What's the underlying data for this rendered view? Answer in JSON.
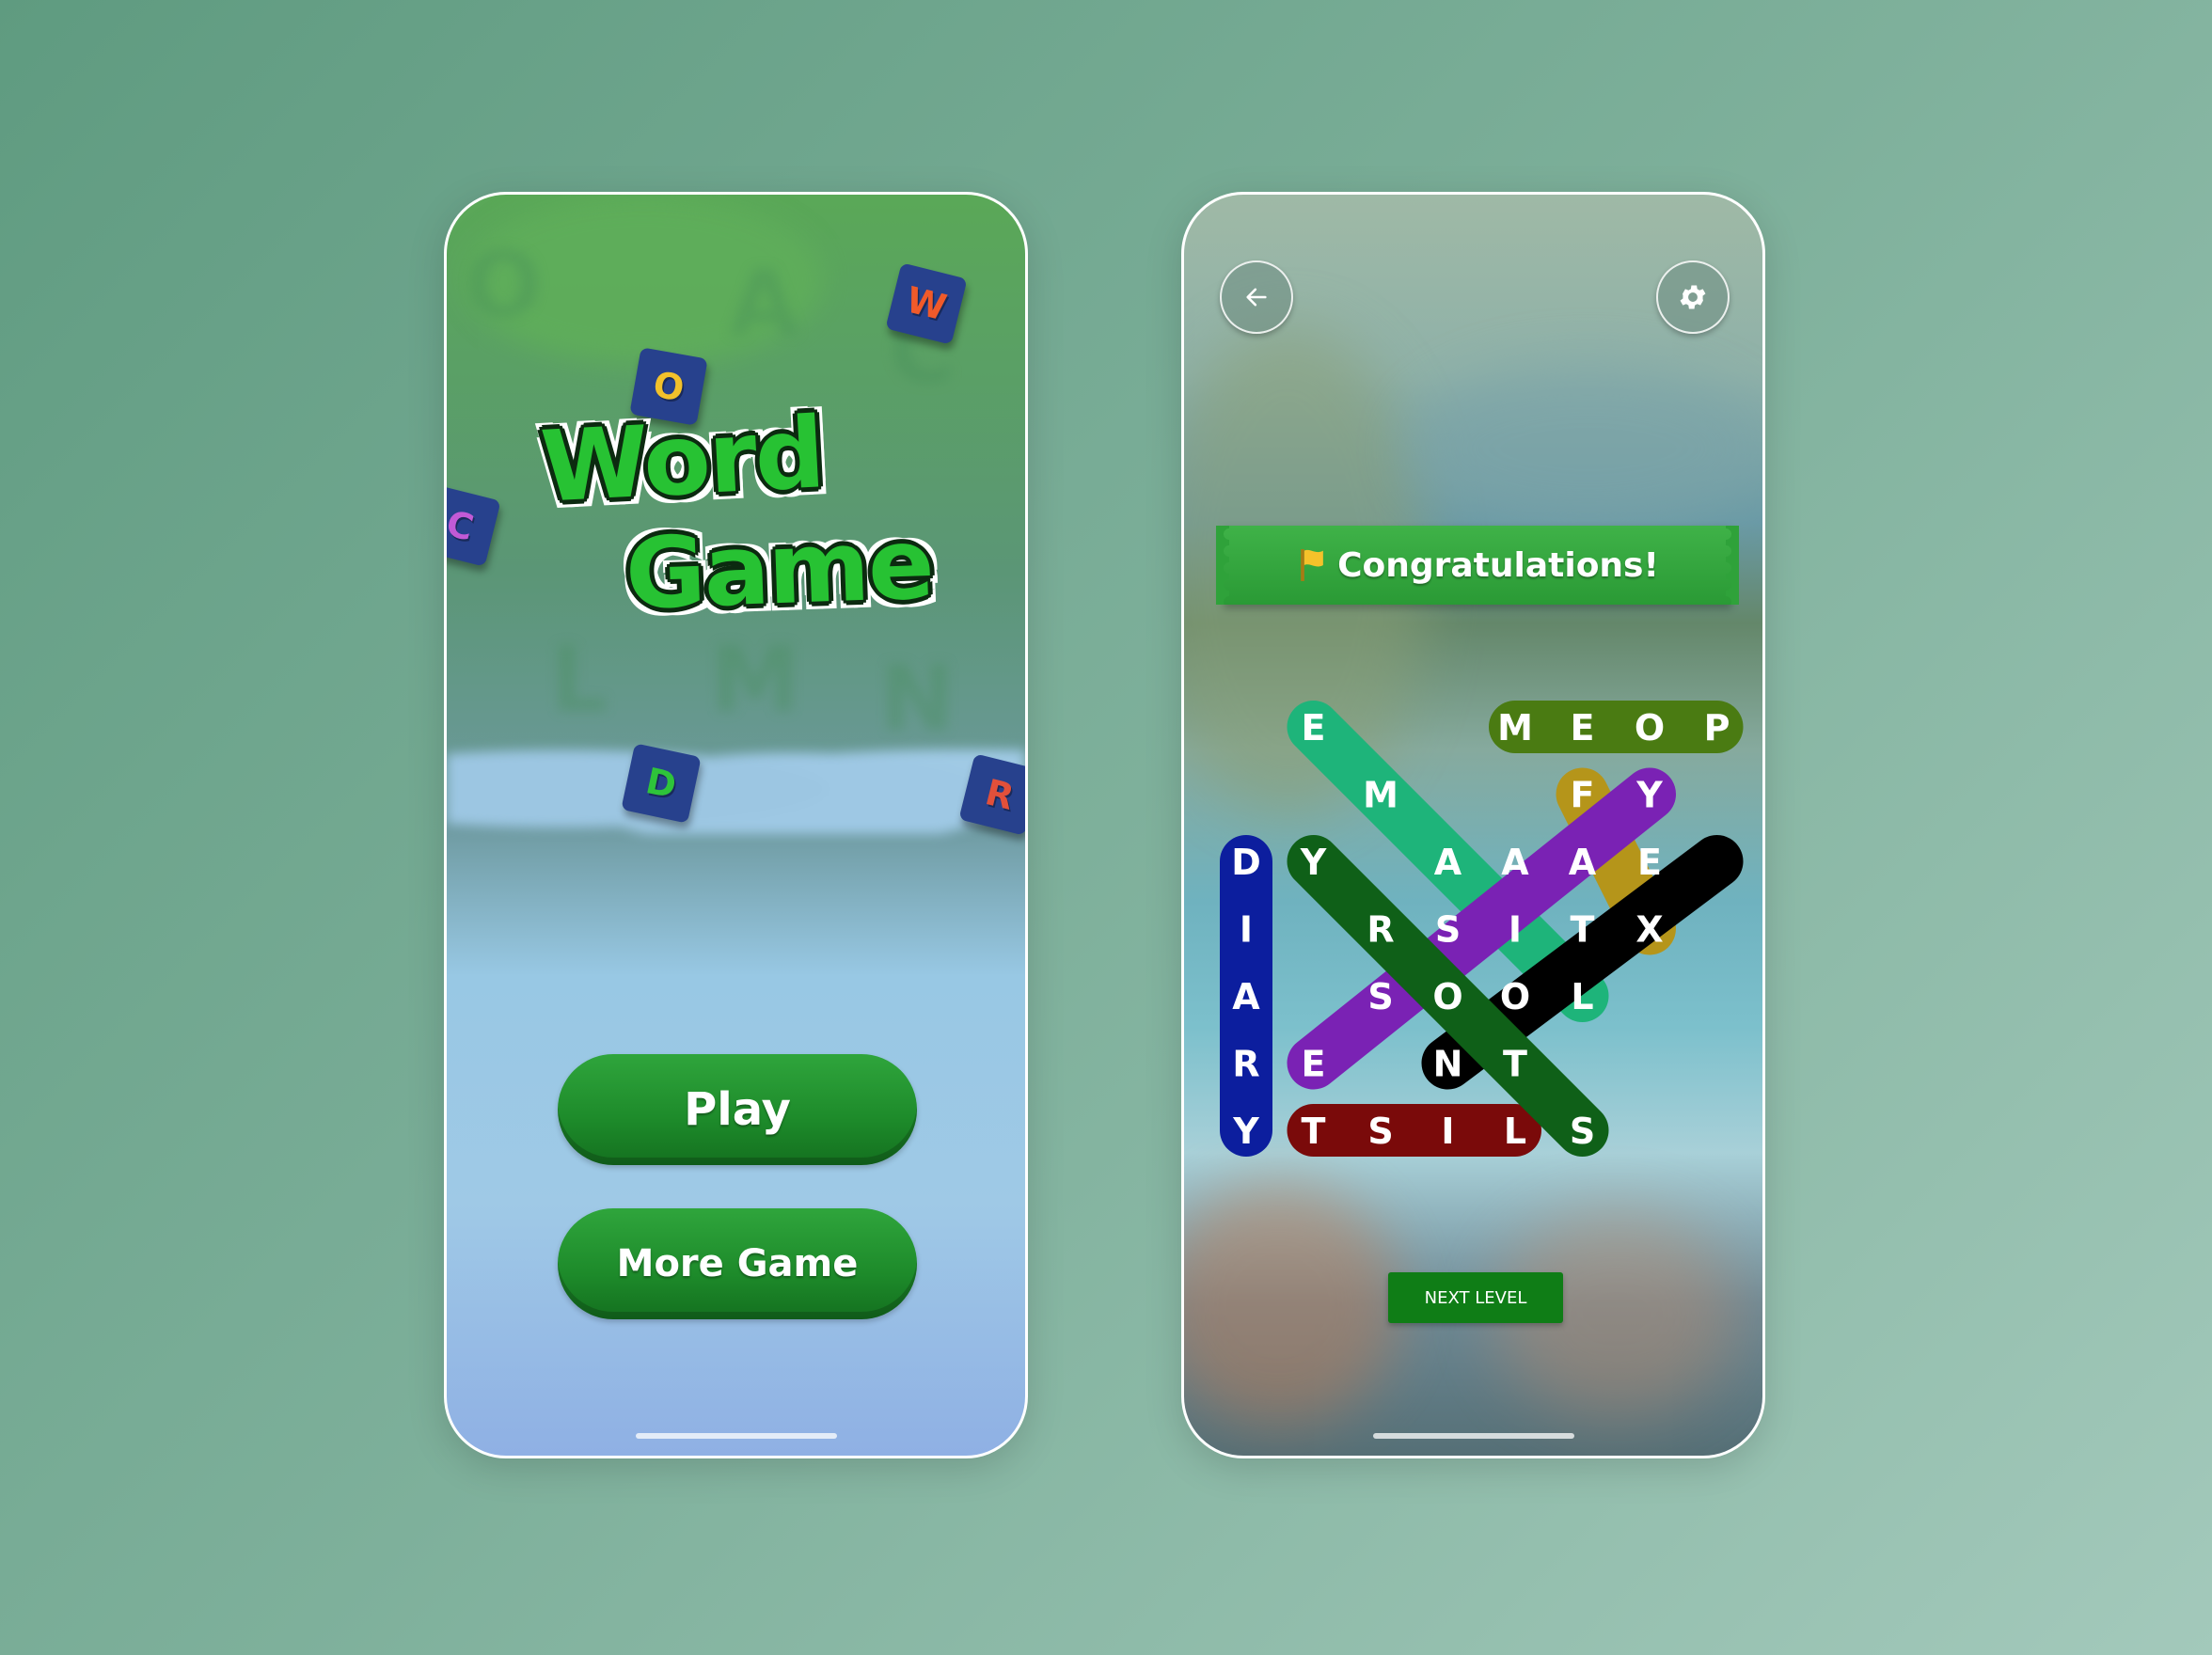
{
  "menu_screen": {
    "logo_line1": "Word",
    "logo_line2": "Game",
    "play_label": "Play",
    "more_label": "More Game",
    "tiles": [
      {
        "letter": "W",
        "color": "#f05a2a"
      },
      {
        "letter": "O",
        "color": "#f2c12b"
      },
      {
        "letter": "C",
        "color": "#c25ad6"
      },
      {
        "letter": "D",
        "color": "#2ec43a"
      },
      {
        "letter": "R",
        "color": "#e2503a"
      }
    ],
    "faded_letters": [
      "O",
      "A",
      "C",
      "L",
      "M",
      "N"
    ]
  },
  "game_screen": {
    "back_icon": "arrow-left-icon",
    "settings_icon": "gear-icon",
    "banner_text": "Congratulations!",
    "banner_icon": "flag-icon",
    "next_label": "NEXT LEVEL",
    "colors": {
      "blue": "#0c1e9e",
      "teal": "#1eb47a",
      "olive": "#4a7b12",
      "gold": "#b5951a",
      "purple": "#7a22b4",
      "black": "#000000",
      "green": "#0f6018",
      "maroon": "#7a0a0a"
    },
    "grid": [
      [
        "",
        "E",
        "",
        "",
        "M",
        "E",
        "O",
        "P"
      ],
      [
        "",
        "",
        "M",
        "",
        "",
        "F",
        "Y",
        ""
      ],
      [
        "D",
        "Y",
        "",
        "A",
        "A",
        "A",
        "E",
        ""
      ],
      [
        "I",
        "",
        "R",
        "S",
        "I",
        "T",
        "X",
        ""
      ],
      [
        "A",
        "",
        "S",
        "O",
        "O",
        "L",
        "",
        ""
      ],
      [
        "R",
        "E",
        "",
        "N",
        "T",
        "",
        "",
        ""
      ],
      [
        "Y",
        "T",
        "S",
        "I",
        "L",
        "S",
        "",
        ""
      ]
    ]
  }
}
